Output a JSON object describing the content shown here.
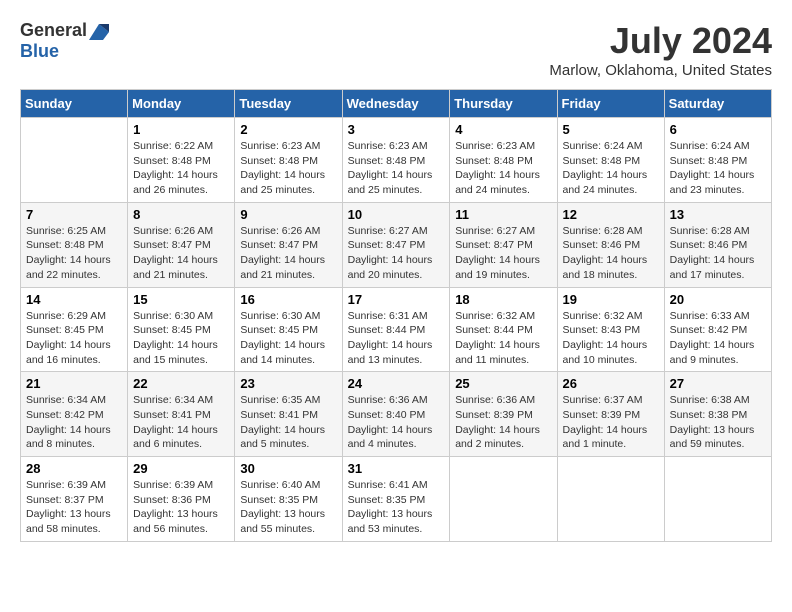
{
  "header": {
    "logo_general": "General",
    "logo_blue": "Blue",
    "month_year": "July 2024",
    "location": "Marlow, Oklahoma, United States"
  },
  "calendar": {
    "days_of_week": [
      "Sunday",
      "Monday",
      "Tuesday",
      "Wednesday",
      "Thursday",
      "Friday",
      "Saturday"
    ],
    "weeks": [
      [
        {
          "day": "",
          "sunrise": "",
          "sunset": "",
          "daylight": ""
        },
        {
          "day": "1",
          "sunrise": "Sunrise: 6:22 AM",
          "sunset": "Sunset: 8:48 PM",
          "daylight": "Daylight: 14 hours and 26 minutes."
        },
        {
          "day": "2",
          "sunrise": "Sunrise: 6:23 AM",
          "sunset": "Sunset: 8:48 PM",
          "daylight": "Daylight: 14 hours and 25 minutes."
        },
        {
          "day": "3",
          "sunrise": "Sunrise: 6:23 AM",
          "sunset": "Sunset: 8:48 PM",
          "daylight": "Daylight: 14 hours and 25 minutes."
        },
        {
          "day": "4",
          "sunrise": "Sunrise: 6:23 AM",
          "sunset": "Sunset: 8:48 PM",
          "daylight": "Daylight: 14 hours and 24 minutes."
        },
        {
          "day": "5",
          "sunrise": "Sunrise: 6:24 AM",
          "sunset": "Sunset: 8:48 PM",
          "daylight": "Daylight: 14 hours and 24 minutes."
        },
        {
          "day": "6",
          "sunrise": "Sunrise: 6:24 AM",
          "sunset": "Sunset: 8:48 PM",
          "daylight": "Daylight: 14 hours and 23 minutes."
        }
      ],
      [
        {
          "day": "7",
          "sunrise": "Sunrise: 6:25 AM",
          "sunset": "Sunset: 8:48 PM",
          "daylight": "Daylight: 14 hours and 22 minutes."
        },
        {
          "day": "8",
          "sunrise": "Sunrise: 6:26 AM",
          "sunset": "Sunset: 8:47 PM",
          "daylight": "Daylight: 14 hours and 21 minutes."
        },
        {
          "day": "9",
          "sunrise": "Sunrise: 6:26 AM",
          "sunset": "Sunset: 8:47 PM",
          "daylight": "Daylight: 14 hours and 21 minutes."
        },
        {
          "day": "10",
          "sunrise": "Sunrise: 6:27 AM",
          "sunset": "Sunset: 8:47 PM",
          "daylight": "Daylight: 14 hours and 20 minutes."
        },
        {
          "day": "11",
          "sunrise": "Sunrise: 6:27 AM",
          "sunset": "Sunset: 8:47 PM",
          "daylight": "Daylight: 14 hours and 19 minutes."
        },
        {
          "day": "12",
          "sunrise": "Sunrise: 6:28 AM",
          "sunset": "Sunset: 8:46 PM",
          "daylight": "Daylight: 14 hours and 18 minutes."
        },
        {
          "day": "13",
          "sunrise": "Sunrise: 6:28 AM",
          "sunset": "Sunset: 8:46 PM",
          "daylight": "Daylight: 14 hours and 17 minutes."
        }
      ],
      [
        {
          "day": "14",
          "sunrise": "Sunrise: 6:29 AM",
          "sunset": "Sunset: 8:45 PM",
          "daylight": "Daylight: 14 hours and 16 minutes."
        },
        {
          "day": "15",
          "sunrise": "Sunrise: 6:30 AM",
          "sunset": "Sunset: 8:45 PM",
          "daylight": "Daylight: 14 hours and 15 minutes."
        },
        {
          "day": "16",
          "sunrise": "Sunrise: 6:30 AM",
          "sunset": "Sunset: 8:45 PM",
          "daylight": "Daylight: 14 hours and 14 minutes."
        },
        {
          "day": "17",
          "sunrise": "Sunrise: 6:31 AM",
          "sunset": "Sunset: 8:44 PM",
          "daylight": "Daylight: 14 hours and 13 minutes."
        },
        {
          "day": "18",
          "sunrise": "Sunrise: 6:32 AM",
          "sunset": "Sunset: 8:44 PM",
          "daylight": "Daylight: 14 hours and 11 minutes."
        },
        {
          "day": "19",
          "sunrise": "Sunrise: 6:32 AM",
          "sunset": "Sunset: 8:43 PM",
          "daylight": "Daylight: 14 hours and 10 minutes."
        },
        {
          "day": "20",
          "sunrise": "Sunrise: 6:33 AM",
          "sunset": "Sunset: 8:42 PM",
          "daylight": "Daylight: 14 hours and 9 minutes."
        }
      ],
      [
        {
          "day": "21",
          "sunrise": "Sunrise: 6:34 AM",
          "sunset": "Sunset: 8:42 PM",
          "daylight": "Daylight: 14 hours and 8 minutes."
        },
        {
          "day": "22",
          "sunrise": "Sunrise: 6:34 AM",
          "sunset": "Sunset: 8:41 PM",
          "daylight": "Daylight: 14 hours and 6 minutes."
        },
        {
          "day": "23",
          "sunrise": "Sunrise: 6:35 AM",
          "sunset": "Sunset: 8:41 PM",
          "daylight": "Daylight: 14 hours and 5 minutes."
        },
        {
          "day": "24",
          "sunrise": "Sunrise: 6:36 AM",
          "sunset": "Sunset: 8:40 PM",
          "daylight": "Daylight: 14 hours and 4 minutes."
        },
        {
          "day": "25",
          "sunrise": "Sunrise: 6:36 AM",
          "sunset": "Sunset: 8:39 PM",
          "daylight": "Daylight: 14 hours and 2 minutes."
        },
        {
          "day": "26",
          "sunrise": "Sunrise: 6:37 AM",
          "sunset": "Sunset: 8:39 PM",
          "daylight": "Daylight: 14 hours and 1 minute."
        },
        {
          "day": "27",
          "sunrise": "Sunrise: 6:38 AM",
          "sunset": "Sunset: 8:38 PM",
          "daylight": "Daylight: 13 hours and 59 minutes."
        }
      ],
      [
        {
          "day": "28",
          "sunrise": "Sunrise: 6:39 AM",
          "sunset": "Sunset: 8:37 PM",
          "daylight": "Daylight: 13 hours and 58 minutes."
        },
        {
          "day": "29",
          "sunrise": "Sunrise: 6:39 AM",
          "sunset": "Sunset: 8:36 PM",
          "daylight": "Daylight: 13 hours and 56 minutes."
        },
        {
          "day": "30",
          "sunrise": "Sunrise: 6:40 AM",
          "sunset": "Sunset: 8:35 PM",
          "daylight": "Daylight: 13 hours and 55 minutes."
        },
        {
          "day": "31",
          "sunrise": "Sunrise: 6:41 AM",
          "sunset": "Sunset: 8:35 PM",
          "daylight": "Daylight: 13 hours and 53 minutes."
        },
        {
          "day": "",
          "sunrise": "",
          "sunset": "",
          "daylight": ""
        },
        {
          "day": "",
          "sunrise": "",
          "sunset": "",
          "daylight": ""
        },
        {
          "day": "",
          "sunrise": "",
          "sunset": "",
          "daylight": ""
        }
      ]
    ]
  }
}
